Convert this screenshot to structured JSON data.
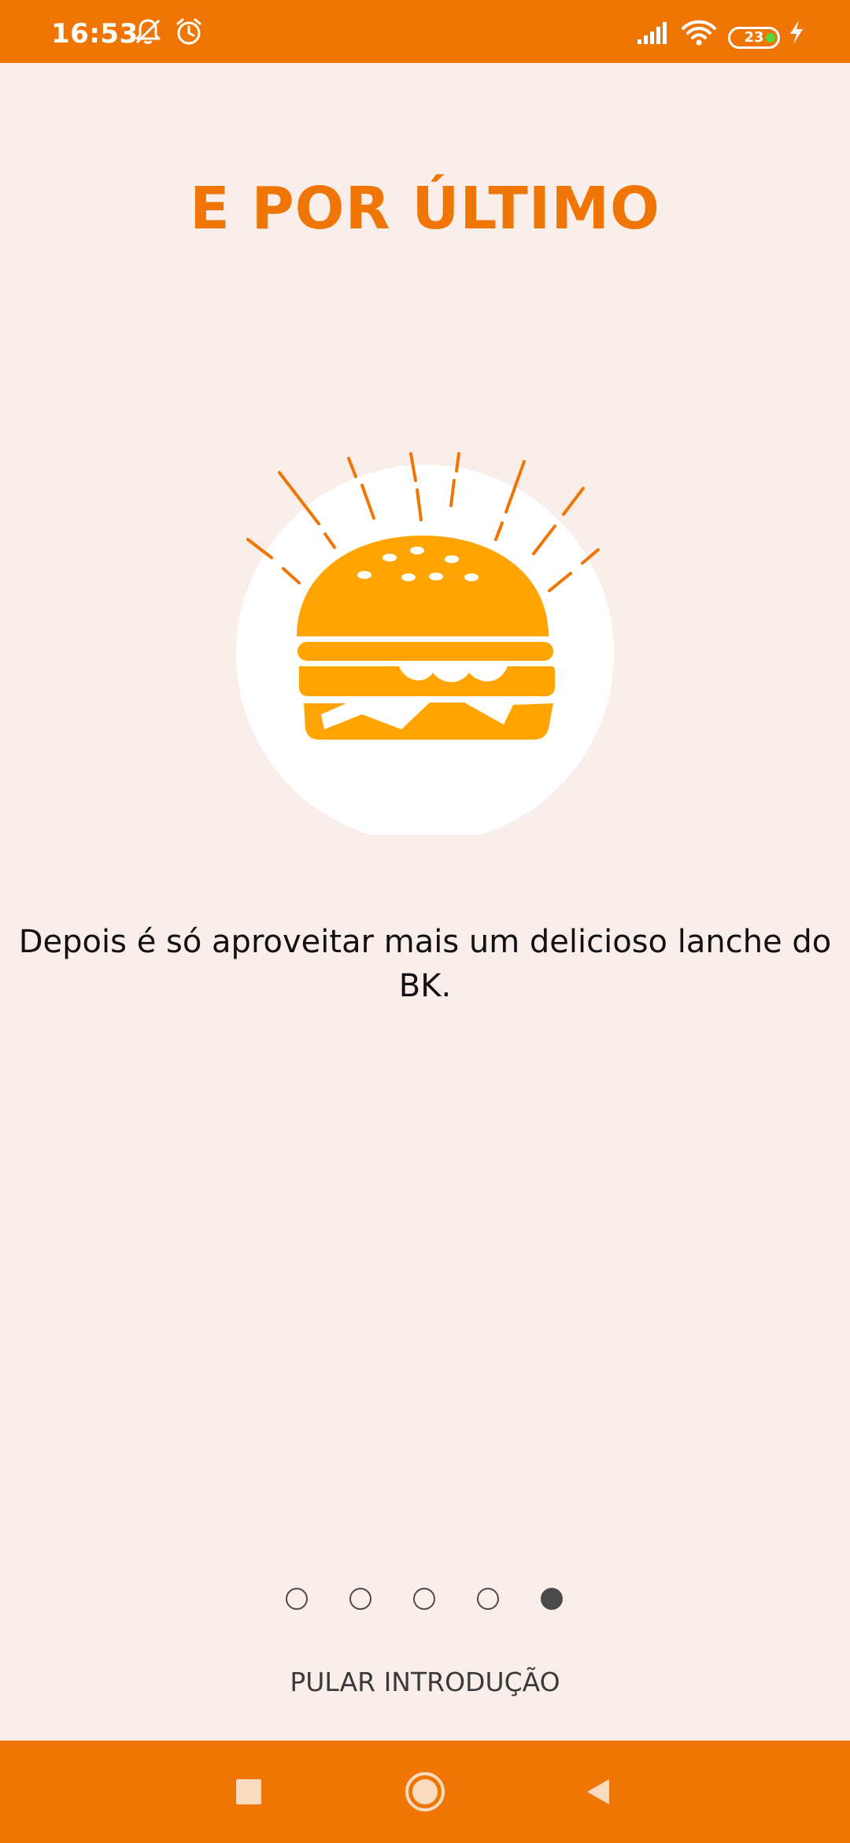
{
  "status_bar": {
    "time": "16:53",
    "battery_level": "23",
    "icons": [
      "bell-muted-icon",
      "alarm-clock-icon",
      "signal-icon",
      "wifi-icon",
      "battery-icon",
      "charging-bolt-icon"
    ]
  },
  "onboarding": {
    "title": "E POR ÚLTIMO",
    "illustration_icon": "burger-icon",
    "description": "Depois é só aproveitar mais um delicioso lanche do BK.",
    "page_count": 5,
    "current_page": 5,
    "skip_label": "PULAR INTRODUÇÃO"
  },
  "nav_bar": {
    "icons": [
      "recents-square-icon",
      "home-circle-icon",
      "back-triangle-icon"
    ]
  },
  "colors": {
    "accent": "#EF7605",
    "background": "#F9EEEA",
    "burger": "#FFA400",
    "rays": "#EF7605",
    "text": "#111111"
  }
}
